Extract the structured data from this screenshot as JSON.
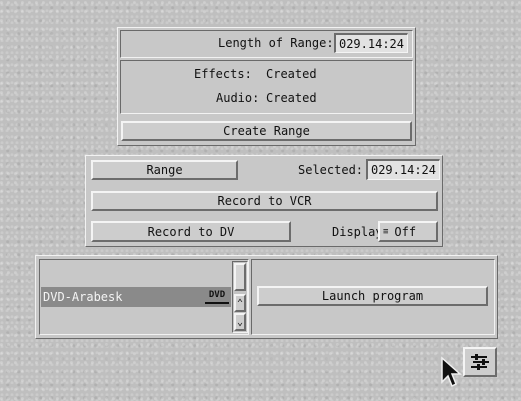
{
  "range_panel": {
    "length_label": "Length of Range:",
    "length_value": "029.14:24",
    "effects_label": "Effects:",
    "effects_value": "Created",
    "audio_label": "Audio:",
    "audio_value": "Created",
    "create_range_label": "Create Range"
  },
  "record_panel": {
    "range_button_label": "Range",
    "selected_label": "Selected:",
    "selected_value": "029.14:24",
    "record_vcr_label": "Record to VCR",
    "record_dv_label": "Record to DV",
    "display_label": "Display",
    "display_value": "Off"
  },
  "program_panel": {
    "items": [
      {
        "label": "DVD-Arabesk",
        "badge": "DVD",
        "selected": true
      }
    ],
    "launch_label": "Launch program"
  },
  "icons": {
    "settings": "sliders-icon",
    "cursor": "mouse-pointer-icon"
  }
}
